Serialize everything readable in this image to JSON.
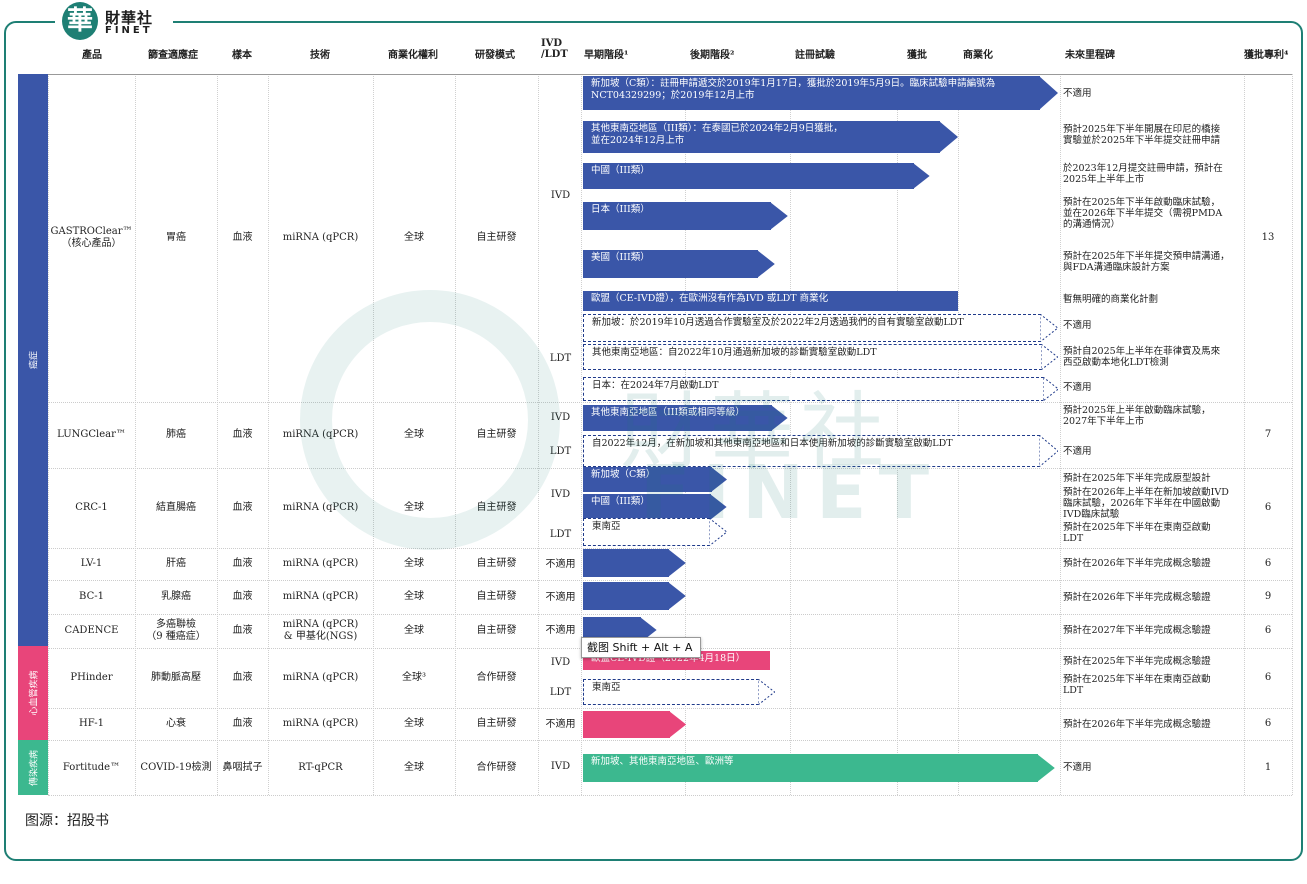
{
  "brand": {
    "cn": "財華社",
    "en": "FINET",
    "icon_char": "華"
  },
  "headers": {
    "product": "產品",
    "indication": "篩查適應症",
    "sample": "樣本",
    "technology": "技術",
    "rights": "商業化權利",
    "model": "研發模式",
    "ivd": "IVD\n/LDT",
    "early": "早期階段¹",
    "late": "後期階段²",
    "registration": "註冊試驗",
    "approval": "獲批",
    "commercial": "商業化",
    "milestones": "未來里程碑",
    "patents": "獲批專利⁴"
  },
  "bands": [
    {
      "label": "癌症",
      "color": "#3a56a8"
    },
    {
      "label": "心血管疾病",
      "color": "#e8457a"
    },
    {
      "label": "傳染疾病",
      "color": "#3cb88f"
    }
  ],
  "products": [
    {
      "name": "GASTROClear™\n（核心產品）",
      "indication": "胃癌",
      "sample": "血液",
      "tech": "miRNA (qPCR)",
      "rights": "全球",
      "model": "自主研發",
      "patents": "13"
    },
    {
      "name": "LUNGClear™",
      "indication": "肺癌",
      "sample": "血液",
      "tech": "miRNA (qPCR)",
      "rights": "全球",
      "model": "自主研發",
      "patents": "7"
    },
    {
      "name": "CRC-1",
      "indication": "結直腸癌",
      "sample": "血液",
      "tech": "miRNA (qPCR)",
      "rights": "全球",
      "model": "自主研發",
      "patents": "6"
    },
    {
      "name": "LV-1",
      "indication": "肝癌",
      "sample": "血液",
      "tech": "miRNA (qPCR)",
      "rights": "全球",
      "model": "自主研發",
      "patents": "6"
    },
    {
      "name": "BC-1",
      "indication": "乳腺癌",
      "sample": "血液",
      "tech": "miRNA (qPCR)",
      "rights": "全球",
      "model": "自主研發",
      "patents": "9"
    },
    {
      "name": "CADENCE",
      "indication": "多癌聯檢\n（9 種癌症）",
      "sample": "血液",
      "tech": "miRNA (qPCR)\n& 甲基化(NGS)",
      "rights": "全球",
      "model": "自主研發",
      "patents": "6"
    },
    {
      "name": "PHinder",
      "indication": "肺動脈高壓",
      "sample": "血液",
      "tech": "miRNA (qPCR)",
      "rights": "全球³",
      "model": "合作研發",
      "patents": "6"
    },
    {
      "name": "HF-1",
      "indication": "心衰",
      "sample": "血液",
      "tech": "miRNA (qPCR)",
      "rights": "全球",
      "model": "自主研發",
      "patents": "6"
    },
    {
      "name": "Fortitude™",
      "indication": "COVID-19檢測",
      "sample": "鼻咽拭子",
      "tech": "RT-qPCR",
      "rights": "全球",
      "model": "合作研發",
      "patents": "1"
    }
  ],
  "ivd_labels": [
    "IVD",
    "LDT",
    "IVD",
    "LDT",
    "IVD",
    "LDT",
    "不適用",
    "不適用",
    "不適用",
    "IVD",
    "LDT",
    "不適用",
    "IVD"
  ],
  "bars": [
    {
      "text": "新加坡（C類）：註冊申請遞交於2019年1月17日，獲批於2019年5月9日。臨床試驗申請編號為\nNCT04329299；於2019年12月上市",
      "style": "solid",
      "color": "#3a56a8",
      "progress": "commercial",
      "milestone": "不適用"
    },
    {
      "text": "其他東南亞地區（III類）：在泰國已於2024年2月9日獲批，\n並在2024年12月上市",
      "style": "solid",
      "color": "#3a56a8",
      "progress": "approval",
      "milestone": "預計2025年下半年開展在印尼的橋接\n實驗並於2025年下半年提交註冊申請"
    },
    {
      "text": "中國（III類）",
      "style": "solid",
      "color": "#3a56a8",
      "progress": "approval-",
      "milestone": "於2023年12月提交註冊申請，預計在\n2025年上半年上市"
    },
    {
      "text": "日本（III類）",
      "style": "solid",
      "color": "#3a56a8",
      "progress": "late",
      "milestone": "預計在2025年下半年啟動臨床試驗，\n並在2026年下半年提交（需視PMDA\n的溝通情況）"
    },
    {
      "text": "美國（III類）",
      "style": "solid",
      "color": "#3a56a8",
      "progress": "late-",
      "milestone": "預計在2025年下半年提交預申請溝通，\n與FDA溝通臨床設計方案"
    },
    {
      "text": "歐盟（CE-IVD證），在歐洲沒有作為IVD 或LDT 商業化",
      "style": "flat",
      "color": "#3a56a8",
      "progress": "approval",
      "milestone": "暫無明確的商業化計劃"
    },
    {
      "text": "新加坡：於2019年10月透過合作實驗室及於2022年2月透過我們的自有實驗室啟動LDT",
      "style": "dash",
      "color": "#1f3a8a",
      "progress": "commercial",
      "milestone": "不適用"
    },
    {
      "text": "其他東南亞地區：自2022年10月通過新加坡的診斷實驗室啟動LDT",
      "style": "dash",
      "color": "#1f3a8a",
      "progress": "commercial",
      "milestone": "預計自2025年上半年在菲律賓及馬來\n西亞啟動本地化LDT檢測"
    },
    {
      "text": "日本：在2024年7月啟動LDT",
      "style": "dash",
      "color": "#1f3a8a",
      "progress": "commercial",
      "milestone": "不適用"
    },
    {
      "text": "其他東南亞地區（III類或相同等級）",
      "style": "solid",
      "color": "#3a56a8",
      "progress": "late",
      "milestone": "預計2025年上半年啟動臨床試驗，\n2027年下半年上市"
    },
    {
      "text": "自2022年12月，在新加坡和其他東南亞地區和日本使用新加坡的診斷實驗室啟動LDT",
      "style": "dash",
      "color": "#1f3a8a",
      "progress": "commercial",
      "milestone": "不適用"
    },
    {
      "text": "新加坡（C類）",
      "style": "solid",
      "color": "#3a56a8",
      "progress": "early",
      "milestone": "預計在2025年下半年完成原型設計"
    },
    {
      "text": "中國（III類）",
      "style": "solid",
      "color": "#3a56a8",
      "progress": "early",
      "milestone": "預計在2026年上半年在新加坡啟動IVD\n臨床試驗，2026年下半年在中國啟動\nIVD臨床試驗"
    },
    {
      "text": "東南亞",
      "style": "dash",
      "color": "#1f3a8a",
      "progress": "early",
      "milestone": "預計在2025年下半年在東南亞啟動\nLDT"
    },
    {
      "text": "",
      "style": "solid",
      "color": "#3a56a8",
      "progress": "early-",
      "milestone": "預計在2026年下半年完成概念驗證"
    },
    {
      "text": "",
      "style": "solid",
      "color": "#3a56a8",
      "progress": "early-",
      "milestone": "預計在2026年下半年完成概念驗證"
    },
    {
      "text": "",
      "style": "solid",
      "color": "#3a56a8",
      "progress": "early-",
      "milestone": "預計在2027年下半年完成概念驗證"
    },
    {
      "text": "歐盟CE-IVD證（2022年4月18日）",
      "style": "flat",
      "color": "#e8457a",
      "progress": "late",
      "milestone": "預計在2025年下半年完成概念驗證"
    },
    {
      "text": "東南亞",
      "style": "dash",
      "color": "#1f3a8a",
      "progress": "late",
      "milestone": "預計在2025年下半年在東南亞啟動\nLDT"
    },
    {
      "text": "",
      "style": "solid",
      "color": "#e8457a",
      "progress": "early",
      "milestone": "預計在2026年下半年完成概念驗證"
    },
    {
      "text": "新加坡、其他東南亞地區、歐洲等",
      "style": "solid",
      "color": "#3cb88f",
      "progress": "commercial",
      "milestone": "不適用"
    }
  ],
  "tooltip": "截图 Shift + Alt + A",
  "watermark": {
    "cn": "財華社",
    "en": "FINET"
  },
  "source": "图源：招股书"
}
